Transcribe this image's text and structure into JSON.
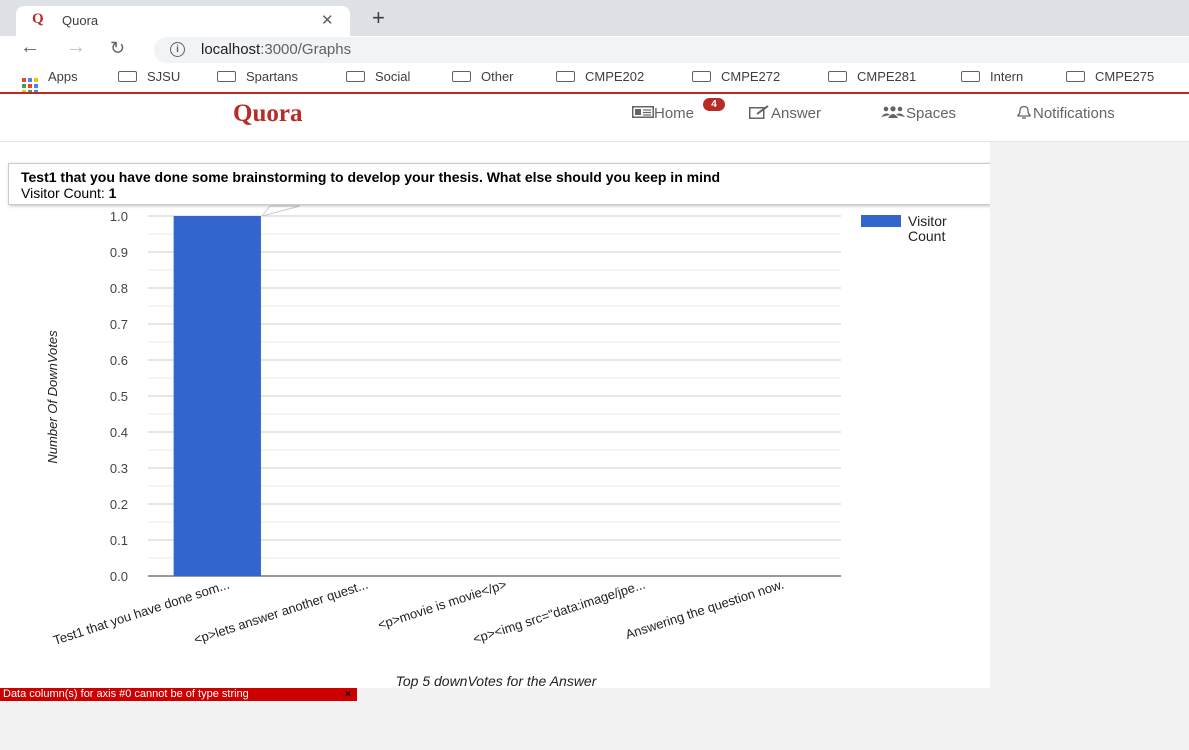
{
  "browser": {
    "tab_title": "Quora",
    "tab_favicon": "Q",
    "url_host": "localhost",
    "url_path": ":3000/Graphs",
    "bookmarks": [
      "Apps",
      "SJSU",
      "Spartans",
      "Social",
      "Other",
      "CMPE202",
      "CMPE272",
      "CMPE281",
      "Intern",
      "CMPE275"
    ]
  },
  "header": {
    "logo": "Quora",
    "nav": [
      {
        "label": "Home",
        "icon": "home-icon"
      },
      {
        "label": "Answer",
        "icon": "answer-icon"
      },
      {
        "label": "Spaces",
        "icon": "spaces-icon"
      },
      {
        "label": "Notifications",
        "icon": "bell-icon"
      }
    ],
    "home_badge": "4"
  },
  "tooltip": {
    "title": "Test1 that you have done some brainstorming to develop your thesis. What else should you keep in mind",
    "count_label": "Visitor Count: ",
    "count_value": "1"
  },
  "error": {
    "message": "Data column(s) for axis #0 cannot be of type string",
    "close": "×"
  },
  "chart_data": {
    "type": "bar",
    "categories": [
      "Test1 that you have done som...",
      "<p>lets answer another quest...",
      "<p>movie is movie</p>",
      "<p><img src=\"data:image/jpe...",
      "Answering the question now."
    ],
    "series": [
      {
        "name": "Visitor Count",
        "values": [
          1,
          0,
          0,
          0,
          0
        ]
      }
    ],
    "ylabel": "Number Of DownVotes",
    "xlabel": "Top 5 downVotes for the Answer",
    "yticks": [
      "0.0",
      "0.1",
      "0.2",
      "0.3",
      "0.4",
      "0.5",
      "0.6",
      "0.7",
      "0.8",
      "0.9",
      "1.0"
    ],
    "ylim": [
      0,
      1
    ],
    "legend_label_lines": [
      "Visitor",
      "Count"
    ],
    "legend_position": "right",
    "bar_color": "#3366cc",
    "grid": true
  }
}
